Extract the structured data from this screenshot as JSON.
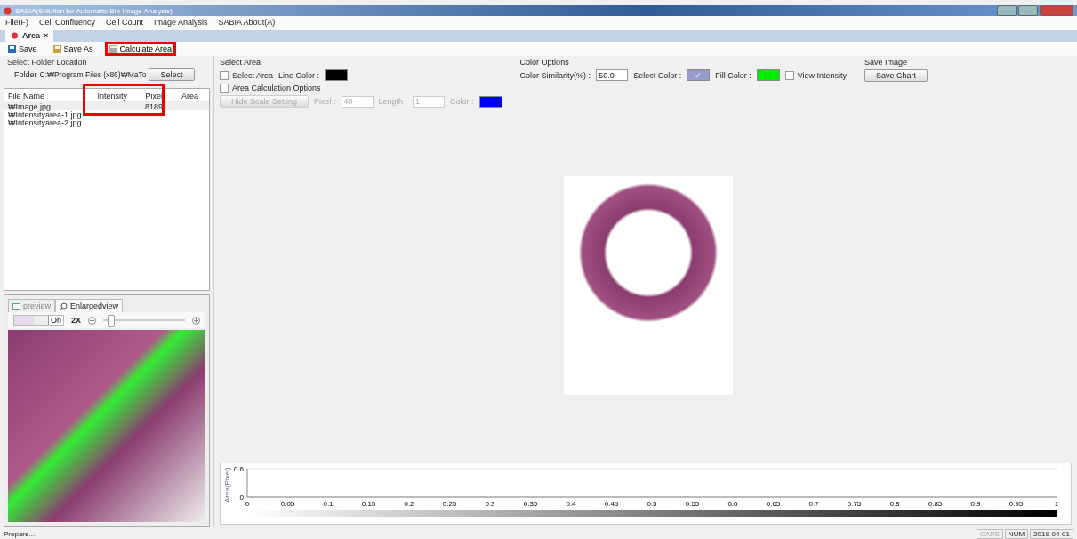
{
  "window": {
    "title": "SABIA(Solution for Automatic Bio-Image Analysis)"
  },
  "menu": [
    "File(F)",
    "Cell Confluency",
    "Cell Count",
    "Image Analysis",
    "SABIA About(A)"
  ],
  "doc_tabs": [
    {
      "label": "Area",
      "close": "×",
      "selected": true
    }
  ],
  "toolbar": [
    {
      "label": "Save",
      "highlighted": false
    },
    {
      "label": "Save As",
      "highlighted": false
    },
    {
      "label": "Calculate Area",
      "highlighted": true
    }
  ],
  "folder": {
    "section": "Select Folder Location",
    "label": "Folder",
    "value": "C:₩Program Files (x86)₩MaTo",
    "button": "Select"
  },
  "file_table": {
    "columns": [
      "File Name",
      "Intensity",
      "Pixel",
      "Area"
    ],
    "highlighted": true,
    "rows": [
      {
        "file_name": "₩Image.jpg",
        "pixel": "8189",
        "selected": true
      },
      {
        "file_name": "₩Intensityarea-1.jpg",
        "selected": false
      },
      {
        "file_name": "₩Intensityarea-2.jpg",
        "selected": false
      }
    ]
  },
  "preview_tabs": [
    {
      "label": "preview",
      "selected": false
    },
    {
      "label": "Enlargedview",
      "selected": true
    }
  ],
  "zoom": {
    "toggle": "On",
    "on": true,
    "zoom_label": "2X",
    "level": 0.05
  },
  "select_area": {
    "title": "Select Area",
    "checkbox": {
      "label": "Select Area",
      "checked": false
    },
    "line_color_label": "Line Color :"
  },
  "color_options": {
    "title": "Color Options",
    "similarity_label": "Color Similarity(%) :",
    "similarity": "50.0",
    "select_color_label": "Select Color :",
    "select_color_mark": "✓",
    "fill_color_label": "Fill Color :",
    "view_intensity": {
      "label": "View Intensity",
      "checked": false
    }
  },
  "save_image": {
    "title": "Save Image",
    "button": "Save Chart"
  },
  "area_calc": {
    "checkbox": {
      "label": "Area Calculation Options",
      "checked": false
    },
    "disabled": true,
    "button": "Hide Scale Setting",
    "pixel_label": "Pixel :",
    "pixel": "40",
    "length_label": "Length :",
    "length": "1",
    "color_label": "Color :"
  },
  "chart": {
    "chart_data": {
      "type": "line",
      "ylabel": "Area(Pixel)",
      "xlim": [
        0,
        1
      ],
      "ylim": [
        0,
        0.6
      ],
      "xticks": [
        0,
        0.05,
        0.1,
        0.15,
        0.2,
        0.25,
        0.3,
        0.35,
        0.4,
        0.45,
        0.5,
        0.55,
        0.6,
        0.65,
        0.7,
        0.75,
        0.8,
        0.85,
        0.9,
        0.95,
        1
      ],
      "yticks": [
        0,
        0.6
      ]
    }
  },
  "status_bar": {
    "text": "Prepare...",
    "indicators": [
      {
        "label": "CAPS",
        "on": false
      },
      {
        "label": "NUM",
        "on": true
      }
    ],
    "date": "2019-04-01"
  }
}
